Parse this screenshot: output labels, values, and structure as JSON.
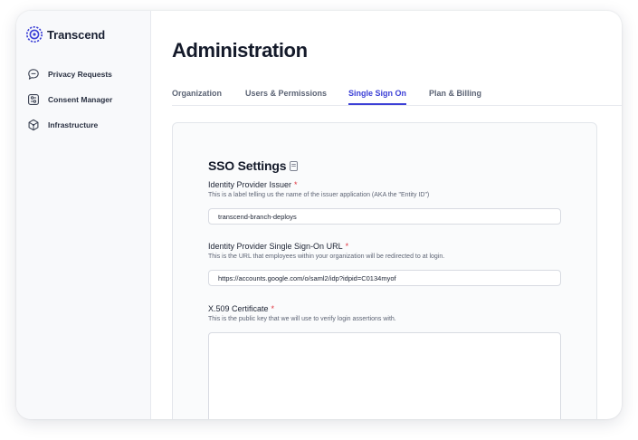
{
  "app": {
    "name": "Transcend",
    "logo_icon": "transcend-logo-icon",
    "accent_color": "#3b3fd6"
  },
  "sidebar": {
    "items": [
      {
        "label": "Privacy Requests",
        "icon": "chat-bubble-icon"
      },
      {
        "label": "Consent Manager",
        "icon": "consent-sliders-icon"
      },
      {
        "label": "Infrastructure",
        "icon": "cube-network-icon"
      }
    ]
  },
  "header": {
    "title": "Administration"
  },
  "tabs": [
    {
      "label": "Organization",
      "active": false
    },
    {
      "label": "Users & Permissions",
      "active": false
    },
    {
      "label": "Single Sign On",
      "active": true
    },
    {
      "label": "Plan & Billing",
      "active": false
    }
  ],
  "sso": {
    "title": "SSO Settings",
    "title_icon": "document-icon",
    "required_marker": "*",
    "required_color": "#e0323c",
    "issuer": {
      "label": "Identity Provider Issuer",
      "help": "This is a label telling us the name of the issuer application (AKA the \"Entity ID\")",
      "value": "transcend-branch-deploys"
    },
    "sso_url": {
      "label": "Identity Provider Single Sign-On URL",
      "help": "This is the URL that employees within your organization will be redirected to at login.",
      "value": "https://accounts.google.com/o/saml2/idp?idpid=C0134myof"
    },
    "certificate": {
      "label": "X.509 Certificate",
      "help": "This is the public key that we will use to verify login assertions with.",
      "value": ""
    }
  }
}
